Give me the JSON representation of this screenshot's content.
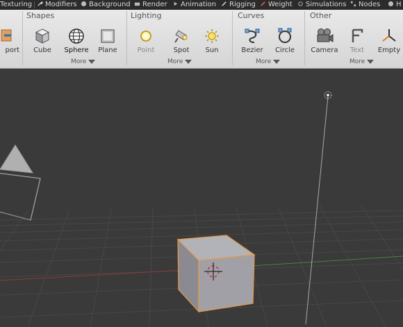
{
  "tabs": [
    "Texturing",
    "Modifiers",
    "Background",
    "Render",
    "Animation",
    "Rigging",
    "Weight",
    "Simulations",
    "Nodes",
    "H"
  ],
  "ribbon": {
    "import_label": "port",
    "groups": [
      {
        "label": "Shapes",
        "more": "More",
        "tools": [
          "Cube",
          "Sphere",
          "Plane"
        ]
      },
      {
        "label": "Lighting",
        "more": "More",
        "tools": [
          "Point",
          "Spot",
          "Sun"
        ]
      },
      {
        "label": "Curves",
        "more": "More",
        "tools": [
          "Bezier",
          "Circle"
        ]
      },
      {
        "label": "Other",
        "more": "More",
        "tools": [
          "Camera",
          "Text",
          "Empty"
        ]
      }
    ]
  },
  "colors": {
    "viewport_bg": "#3a3a3a",
    "grid": "#474747",
    "x_axis": "#8a3b3b",
    "y_axis": "#4f7f3f",
    "selection_outline": "#e79b4b",
    "cube_face": "#9c9ca3",
    "ribbon_bg": "#dedede"
  }
}
